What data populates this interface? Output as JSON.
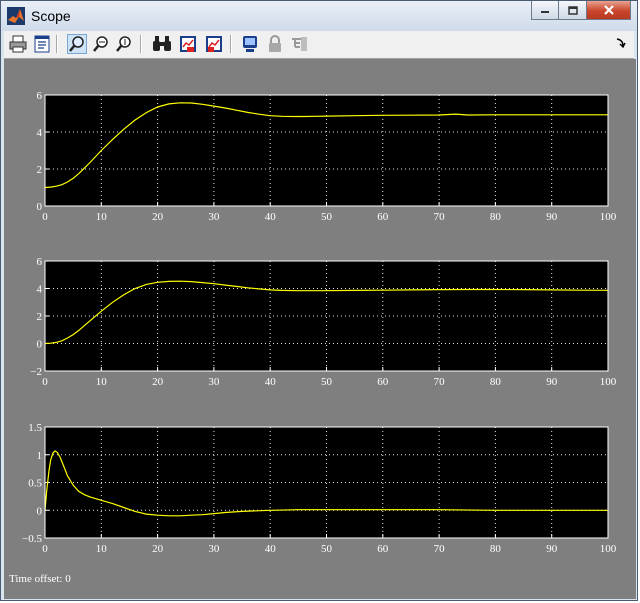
{
  "window": {
    "title": "Scope",
    "icons": {
      "app": "matlab-icon",
      "minimize": "minimize-icon",
      "maximize": "maximize-icon",
      "close": "close-icon"
    }
  },
  "toolbar": {
    "buttons": [
      {
        "name": "print",
        "icon": "printer-icon"
      },
      {
        "name": "parameters",
        "icon": "parameters-icon"
      },
      {
        "name": "zoom",
        "icon": "zoom-icon"
      },
      {
        "name": "zoom-x",
        "icon": "zoom-x-icon"
      },
      {
        "name": "zoom-y",
        "icon": "zoom-y-icon"
      },
      {
        "name": "autoscale",
        "icon": "binoculars-icon"
      },
      {
        "name": "save-axes",
        "icon": "save-axes-icon"
      },
      {
        "name": "restore-axes",
        "icon": "restore-axes-icon"
      },
      {
        "name": "floating-scope",
        "icon": "floating-scope-icon"
      },
      {
        "name": "lock-axes",
        "icon": "lock-icon"
      },
      {
        "name": "signal-selection",
        "icon": "signal-selection-icon"
      }
    ],
    "dock_icon": "dock-arrow-icon"
  },
  "status": {
    "time_offset": "Time offset:  0"
  },
  "colors": {
    "plot_bg": "#000000",
    "frame_bg": "#7f7f7f",
    "trace": "#ffff00",
    "grid": "#ffffff"
  },
  "chart_data": [
    {
      "type": "line",
      "xlim": [
        0,
        100
      ],
      "ylim": [
        0,
        6
      ],
      "xticks": [
        "0",
        "10",
        "20",
        "30",
        "40",
        "50",
        "60",
        "70",
        "80",
        "90",
        "100"
      ],
      "yticks": [
        "0",
        "2",
        "4",
        "6"
      ],
      "ytick_values": [
        0,
        2,
        4,
        6
      ],
      "grid": true,
      "series": [
        {
          "color": "#ffff00",
          "x": [
            0,
            1,
            2,
            3,
            4,
            5,
            6,
            7,
            8,
            10,
            12,
            14,
            16,
            18,
            20,
            22,
            24,
            26,
            28,
            30,
            32,
            34,
            36,
            38,
            40,
            42,
            44,
            46,
            48,
            50,
            55,
            60,
            65,
            70,
            73,
            75,
            80,
            90,
            100
          ],
          "y": [
            1.0,
            1.02,
            1.07,
            1.15,
            1.3,
            1.5,
            1.75,
            2.05,
            2.35,
            3.0,
            3.6,
            4.15,
            4.65,
            5.05,
            5.35,
            5.52,
            5.58,
            5.57,
            5.5,
            5.4,
            5.3,
            5.18,
            5.06,
            4.96,
            4.88,
            4.85,
            4.84,
            4.84,
            4.85,
            4.86,
            4.88,
            4.9,
            4.91,
            4.92,
            4.97,
            4.92,
            4.93,
            4.93,
            4.93
          ]
        }
      ]
    },
    {
      "type": "line",
      "xlim": [
        0,
        100
      ],
      "ylim": [
        -2,
        6
      ],
      "xticks": [
        "0",
        "10",
        "20",
        "30",
        "40",
        "50",
        "60",
        "70",
        "80",
        "90",
        "100"
      ],
      "yticks": [
        "−2",
        "0",
        "2",
        "4",
        "6"
      ],
      "ytick_values": [
        -2,
        0,
        2,
        4,
        6
      ],
      "grid": true,
      "series": [
        {
          "color": "#ffff00",
          "x": [
            0,
            1,
            2,
            3,
            4,
            5,
            6,
            7,
            8,
            10,
            12,
            14,
            16,
            18,
            20,
            22,
            24,
            26,
            28,
            30,
            32,
            34,
            36,
            38,
            40,
            42,
            45,
            50,
            55,
            60,
            65,
            70,
            75,
            80,
            85,
            90,
            95,
            100
          ],
          "y": [
            0,
            0.02,
            0.08,
            0.2,
            0.4,
            0.65,
            0.95,
            1.3,
            1.65,
            2.35,
            3.0,
            3.55,
            4.0,
            4.3,
            4.45,
            4.52,
            4.53,
            4.5,
            4.43,
            4.35,
            4.25,
            4.15,
            4.05,
            3.97,
            3.9,
            3.86,
            3.84,
            3.84,
            3.86,
            3.88,
            3.9,
            3.92,
            3.93,
            3.93,
            3.92,
            3.9,
            3.88,
            3.87
          ]
        }
      ]
    },
    {
      "type": "line",
      "xlim": [
        0,
        100
      ],
      "ylim": [
        -0.5,
        1.5
      ],
      "xticks": [
        "0",
        "10",
        "20",
        "30",
        "40",
        "50",
        "60",
        "70",
        "80",
        "90",
        "100"
      ],
      "yticks": [
        "−0.5",
        "0",
        "0.5",
        "1",
        "1.5"
      ],
      "ytick_values": [
        -0.5,
        0,
        0.5,
        1,
        1.5
      ],
      "grid": true,
      "series": [
        {
          "color": "#ffff00",
          "x": [
            0,
            0.3,
            0.7,
            1,
            1.4,
            1.8,
            2.2,
            2.7,
            3.3,
            4,
            5,
            6,
            7,
            8,
            10,
            12,
            14,
            16,
            18,
            20,
            22,
            24,
            26,
            28,
            30,
            32,
            35,
            40,
            45,
            50,
            60,
            70,
            80,
            90,
            100
          ],
          "y": [
            0,
            0.35,
            0.7,
            0.9,
            1.03,
            1.07,
            1.04,
            0.95,
            0.8,
            0.62,
            0.45,
            0.34,
            0.28,
            0.24,
            0.18,
            0.12,
            0.05,
            -0.02,
            -0.07,
            -0.09,
            -0.1,
            -0.1,
            -0.09,
            -0.08,
            -0.06,
            -0.04,
            -0.02,
            0,
            0.01,
            0.01,
            0.01,
            0.01,
            0.0,
            0.0,
            0.0
          ]
        }
      ]
    }
  ]
}
